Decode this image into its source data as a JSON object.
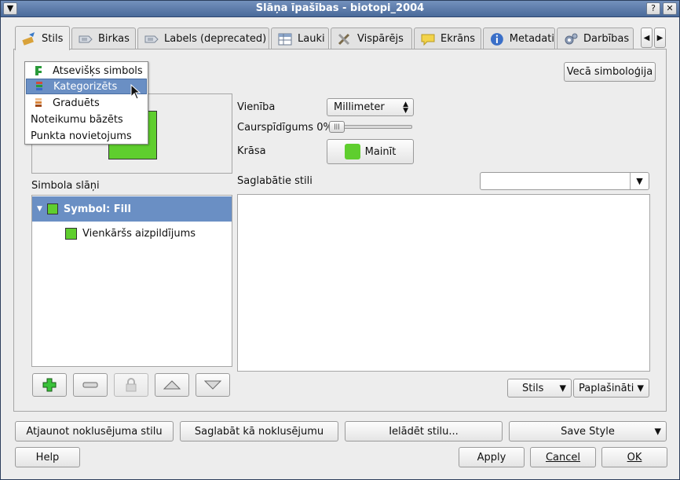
{
  "window": {
    "title": "Slāņa īpašības - biotopi_2004"
  },
  "tabs": [
    {
      "label": "Stils",
      "icon": "brush-icon",
      "active": true
    },
    {
      "label": "Birkas",
      "icon": "label-icon"
    },
    {
      "label": "Labels (deprecated)",
      "icon": "label-icon"
    },
    {
      "label": "Lauki",
      "icon": "table-icon"
    },
    {
      "label": "Vispārējs",
      "icon": "tools-icon"
    },
    {
      "label": "Ekrāns",
      "icon": "speech-bubble-icon"
    },
    {
      "label": "Metadati",
      "icon": "info-icon"
    },
    {
      "label": "Darbības",
      "icon": "gears-icon"
    }
  ],
  "renderer_menu": {
    "items": [
      "Atsevišķs simbols",
      "Kategorizēts",
      "Graduēts",
      "Noteikumu bāzēts",
      "Punkta novietojums"
    ],
    "selected": "Kategorizēts"
  },
  "old_symbology_button": "Vecā simboloģija",
  "symbol_props": {
    "unit_label": "Vienība",
    "unit_value": "Millimeter",
    "transparency_label": "Caurspīdīgums 0%",
    "transparency_value": 0,
    "color_label": "Krāsa",
    "color_button": "Mainīt",
    "fill_color": "#5fce2e"
  },
  "symbol_layers": {
    "title": "Simbola slāņi",
    "root": "Symbol: Fill",
    "child": "Vienkāršs aizpildījums"
  },
  "saved_styles": {
    "label": "Saglabātie stili",
    "combo_value": "",
    "style_filter": "Stils",
    "advanced": "Paplašināti"
  },
  "bottom": {
    "restore_default": "Atjaunot noklusējuma stilu",
    "save_default": "Saglabāt kā noklusējumu",
    "load_style": "Ielādēt stilu...",
    "save_style": "Save Style",
    "help": "Help",
    "apply": "Apply",
    "cancel": "Cancel",
    "ok": "OK"
  },
  "colors": {
    "selection": "#6a8fc4",
    "fill_green": "#5fce2e",
    "title_bar": "#4a6a9a"
  }
}
